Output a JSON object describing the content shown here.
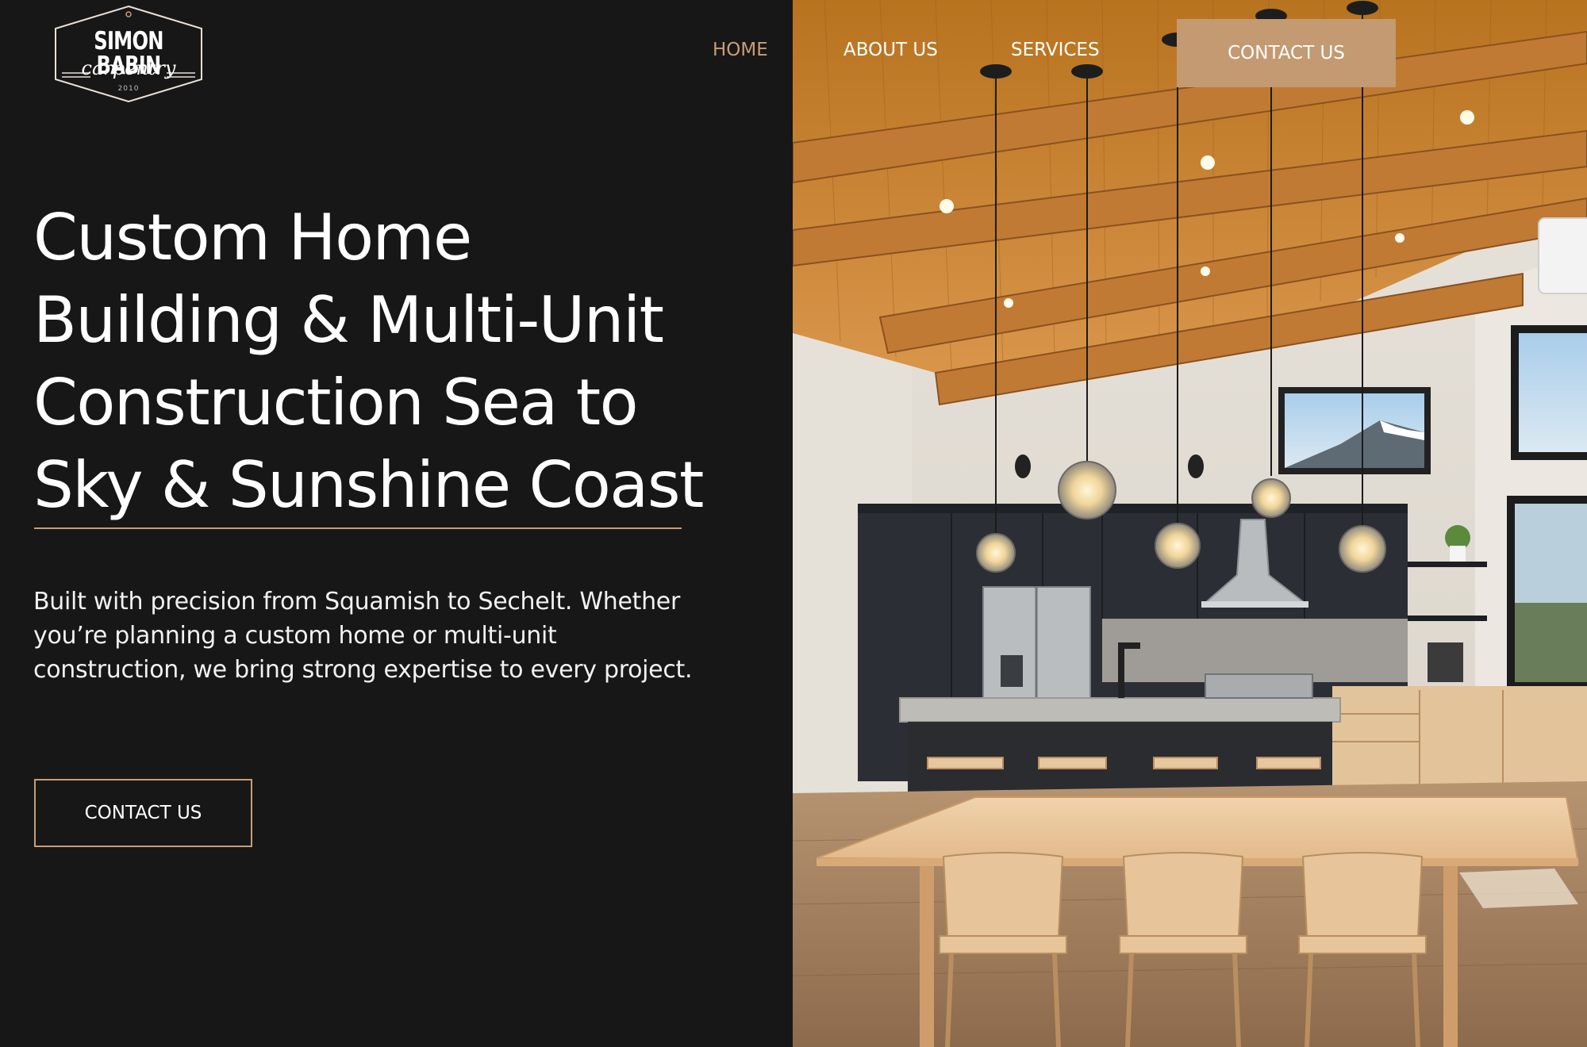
{
  "brand": {
    "name": "SIMON BABIN",
    "script": "carpentry",
    "year": "2010"
  },
  "nav": {
    "home": "HOME",
    "about": "ABOUT US",
    "services": "SERVICES",
    "contact": "CONTACT US",
    "active": "HOME"
  },
  "hero": {
    "title_lines": [
      "Custom Home",
      "Building & Multi-Unit",
      "Construction Sea to",
      "Sky & Sunshine Coast"
    ],
    "subtitle": "Built with precision from Squamish to Sechelt. Whether you’re planning a custom home or multi-unit construction, we bring strong expertise to every project.",
    "cta": "CONTACT US"
  },
  "colors": {
    "background": "#171717",
    "accent": "#c99d76",
    "text": "#ffffff"
  }
}
